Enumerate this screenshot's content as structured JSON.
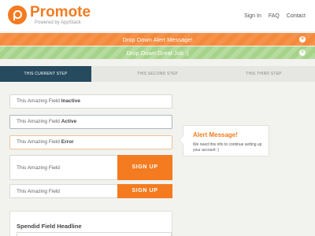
{
  "header": {
    "brand": "Promote",
    "tagline": "Powered by AppStack",
    "nav": [
      "Sign In",
      "FAQ",
      "Contact"
    ]
  },
  "alerts": [
    {
      "text": "Drop Down Alert Message!",
      "close": "×",
      "color": "#f58a3c"
    },
    {
      "text": "Drop Down Great Job :)",
      "close": "×",
      "color": "#a6d38a"
    }
  ],
  "steps": [
    "THIS CURRENT STEP",
    "THIS SECOND STEP",
    "THIS THIRD STEP"
  ],
  "fields": [
    {
      "label": "This Amazing Field",
      "state": "Inactive"
    },
    {
      "label": "This Amazing Field",
      "state": "Active"
    },
    {
      "label": "This Amazing Field",
      "state": "Error"
    }
  ],
  "signup_rows": [
    {
      "label": "This Amazing Field",
      "button": "SIGN UP"
    },
    {
      "label": "This Amazing Field",
      "button": "SIGN UP"
    }
  ],
  "callout": {
    "title": "Alert Message!",
    "body": "We need this info to continue setting up your account :)"
  },
  "panel": {
    "title": "Spendid Field Headline"
  },
  "colors": {
    "accent": "#f47b20",
    "step_active": "#264a5e",
    "success": "#a6d38a"
  }
}
